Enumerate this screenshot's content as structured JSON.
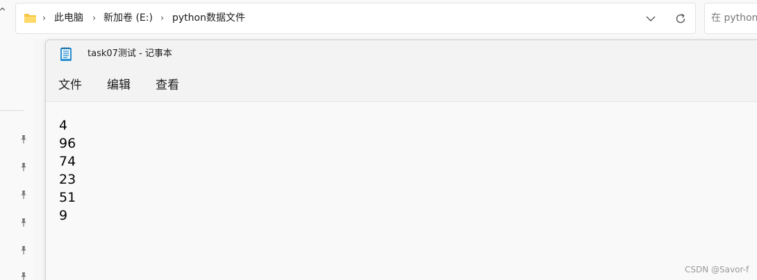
{
  "explorer": {
    "breadcrumb": [
      "此电脑",
      "新加卷 (E:)",
      "python数据文件"
    ],
    "search_placeholder": "在 python"
  },
  "notepad": {
    "title": "task07测试 - 记事本",
    "menu": [
      "文件",
      "编辑",
      "查看"
    ],
    "lines": [
      "4",
      "96",
      "74",
      "23",
      "51",
      "9"
    ]
  },
  "watermark": "CSDN @Savor-f",
  "icons": {
    "folder": "folder-icon",
    "dropdown": "chevron-down-icon",
    "refresh": "refresh-icon",
    "pin": "pin-icon",
    "notepad": "notepad-app-icon"
  },
  "colors": {
    "folder": "#f6c744",
    "notepad_icon": "#2a8fd0"
  }
}
